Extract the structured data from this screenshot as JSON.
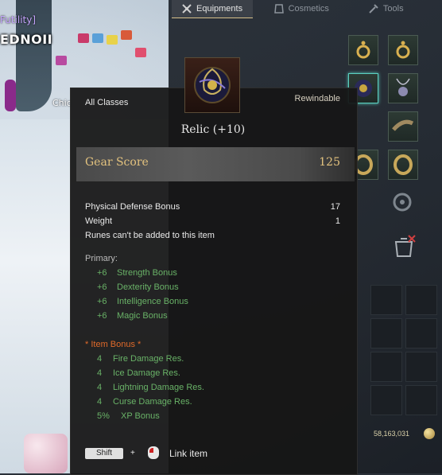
{
  "world": {
    "guild_tag": "Futility]",
    "player_name": "EDNOII",
    "npc_label": "Chic"
  },
  "tabs": [
    {
      "label": "Equipments",
      "icon": "equipment-icon",
      "active": true
    },
    {
      "label": "Cosmetics",
      "icon": "cosmetics-icon",
      "active": false
    },
    {
      "label": "Tools",
      "icon": "tools-icon",
      "active": false
    }
  ],
  "silver": "58,163,031",
  "tooltip": {
    "class_restriction": "All Classes",
    "rewindable": "Rewindable",
    "item_name": "Relic (+10)",
    "gear_score_label": "Gear Score",
    "gear_score": "125",
    "stats": [
      {
        "label": "Physical Defense Bonus",
        "value": "17"
      },
      {
        "label": "Weight",
        "value": "1"
      }
    ],
    "rune_note": "Runes can't be added to this item",
    "primary_label": "Primary:",
    "primary": [
      {
        "value": "+6",
        "label": "Strength Bonus"
      },
      {
        "value": "+6",
        "label": "Dexterity Bonus"
      },
      {
        "value": "+6",
        "label": "Intelligence Bonus"
      },
      {
        "value": "+6",
        "label": "Magic Bonus"
      }
    ],
    "item_bonus_label": "*  Item Bonus  *",
    "item_bonus": [
      {
        "value": "4",
        "label": "Fire Damage Res."
      },
      {
        "value": "4",
        "label": "Ice Damage Res."
      },
      {
        "value": "4",
        "label": "Lightning Damage Res."
      },
      {
        "value": "4",
        "label": "Curse Damage Res."
      },
      {
        "value": "5%",
        "label": "XP Bonus"
      }
    ],
    "shortcut_key": "Shift",
    "shortcut_plus": "+",
    "shortcut_action": "Link item"
  },
  "colors": {
    "gold": "#e3c27e",
    "green": "#69b267",
    "orange": "#e06a2a"
  }
}
